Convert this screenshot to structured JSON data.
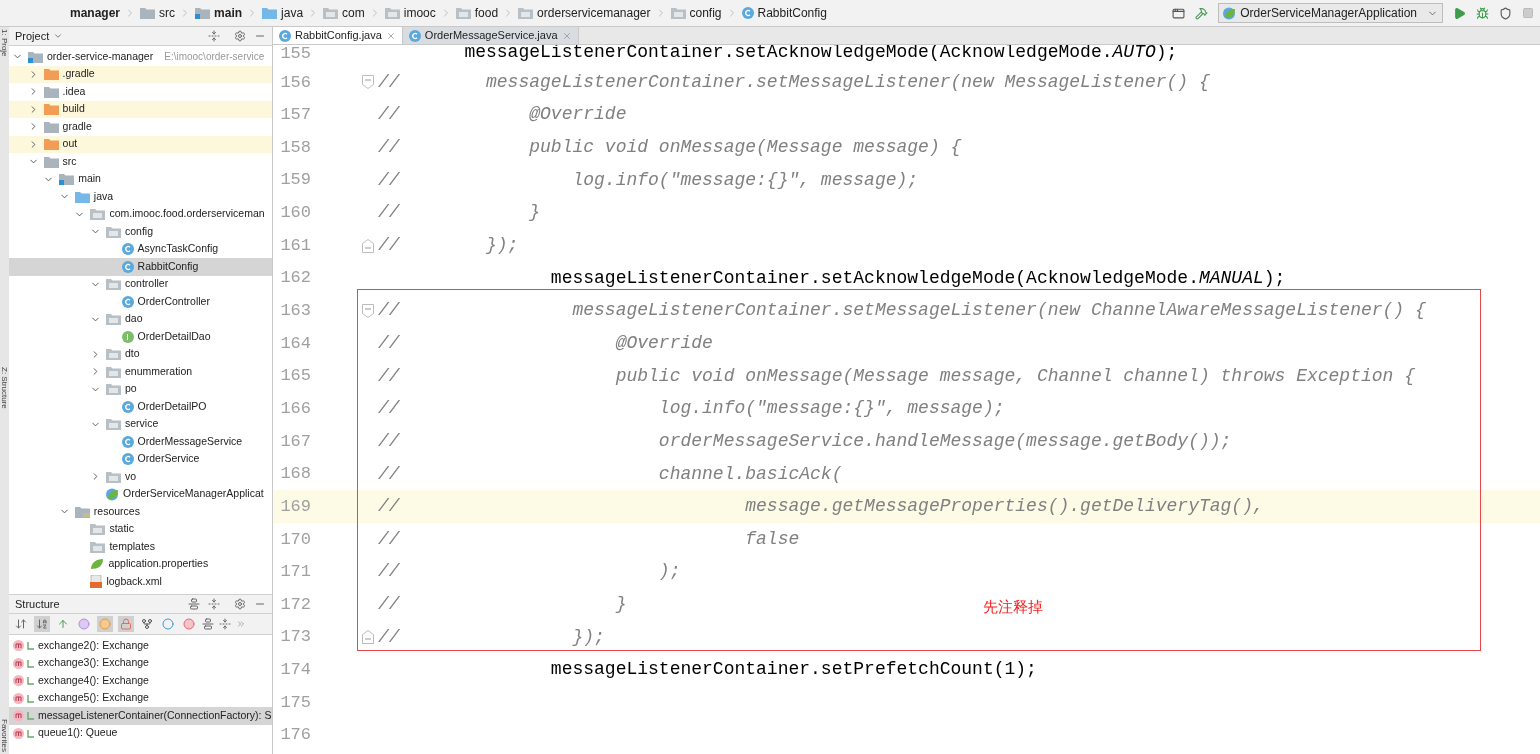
{
  "breadcrumbs": [
    {
      "label": "manager",
      "kind": "module"
    },
    {
      "label": "src",
      "kind": "folder"
    },
    {
      "label": "main",
      "kind": "source-set"
    },
    {
      "label": "java",
      "kind": "source"
    },
    {
      "label": "com",
      "kind": "package"
    },
    {
      "label": "imooc",
      "kind": "package"
    },
    {
      "label": "food",
      "kind": "package"
    },
    {
      "label": "orderservicemanager",
      "kind": "package"
    },
    {
      "label": "config",
      "kind": "package"
    },
    {
      "label": "RabbitConfig",
      "kind": "class"
    }
  ],
  "run_config": {
    "label": "OrderServiceManagerApplication"
  },
  "side_stripe": [
    "1: Proje",
    "Z: Structure",
    "Favorites"
  ],
  "project_panel": {
    "title": "Project",
    "tree": [
      {
        "label": "order-service-manager",
        "hint": "E:\\imooc\\order-service",
        "kind": "module",
        "expanded": true,
        "selected": false,
        "ignored": false,
        "children": [
          {
            "label": ".gradle",
            "kind": "excluded",
            "expanded": false,
            "selected": false,
            "ignored": true
          },
          {
            "label": ".idea",
            "kind": "folder",
            "expanded": false,
            "selected": false,
            "ignored": false
          },
          {
            "label": "build",
            "kind": "excluded",
            "expanded": false,
            "selected": false,
            "ignored": true
          },
          {
            "label": "gradle",
            "kind": "folder",
            "expanded": false,
            "selected": false,
            "ignored": false
          },
          {
            "label": "out",
            "kind": "excluded",
            "expanded": false,
            "selected": false,
            "ignored": true
          },
          {
            "label": "src",
            "kind": "folder",
            "expanded": true,
            "selected": false,
            "ignored": false,
            "children": [
              {
                "label": "main",
                "kind": "source-set",
                "expanded": true,
                "selected": false,
                "ignored": false,
                "children": [
                  {
                    "label": "java",
                    "kind": "source",
                    "expanded": true,
                    "selected": false,
                    "ignored": false,
                    "children": [
                      {
                        "label": "com.imooc.food.orderserviceman",
                        "kind": "package",
                        "expanded": true,
                        "selected": false,
                        "ignored": false,
                        "children": [
                          {
                            "label": "config",
                            "kind": "package",
                            "expanded": true,
                            "selected": false,
                            "ignored": false,
                            "children": [
                              {
                                "label": "AsyncTaskConfig",
                                "kind": "class",
                                "selected": false,
                                "ignored": false
                              },
                              {
                                "label": "RabbitConfig",
                                "kind": "class",
                                "selected": true,
                                "ignored": false
                              }
                            ]
                          },
                          {
                            "label": "controller",
                            "kind": "package",
                            "expanded": true,
                            "selected": false,
                            "ignored": false,
                            "children": [
                              {
                                "label": "OrderController",
                                "kind": "class",
                                "selected": false,
                                "ignored": false
                              }
                            ]
                          },
                          {
                            "label": "dao",
                            "kind": "package",
                            "expanded": true,
                            "selected": false,
                            "ignored": false,
                            "children": [
                              {
                                "label": "OrderDetailDao",
                                "kind": "interface",
                                "selected": false,
                                "ignored": false
                              }
                            ]
                          },
                          {
                            "label": "dto",
                            "kind": "package",
                            "expanded": false,
                            "selected": false,
                            "ignored": false
                          },
                          {
                            "label": "enummeration",
                            "kind": "package",
                            "expanded": false,
                            "selected": false,
                            "ignored": false
                          },
                          {
                            "label": "po",
                            "kind": "package",
                            "expanded": true,
                            "selected": false,
                            "ignored": false,
                            "children": [
                              {
                                "label": "OrderDetailPO",
                                "kind": "class",
                                "selected": false,
                                "ignored": false
                              }
                            ]
                          },
                          {
                            "label": "service",
                            "kind": "package",
                            "expanded": true,
                            "selected": false,
                            "ignored": false,
                            "children": [
                              {
                                "label": "OrderMessageService",
                                "kind": "class",
                                "selected": false,
                                "ignored": false
                              },
                              {
                                "label": "OrderService",
                                "kind": "class",
                                "selected": false,
                                "ignored": false
                              }
                            ]
                          },
                          {
                            "label": "vo",
                            "kind": "package",
                            "expanded": false,
                            "selected": false,
                            "ignored": false
                          },
                          {
                            "label": "OrderServiceManagerApplicat",
                            "kind": "spring-app",
                            "selected": false,
                            "ignored": false
                          }
                        ]
                      }
                    ]
                  },
                  {
                    "label": "resources",
                    "kind": "resources",
                    "expanded": true,
                    "selected": false,
                    "ignored": false,
                    "children": [
                      {
                        "label": "static",
                        "kind": "package",
                        "selected": false,
                        "ignored": false
                      },
                      {
                        "label": "templates",
                        "kind": "package",
                        "selected": false,
                        "ignored": false
                      },
                      {
                        "label": "application.properties",
                        "kind": "properties",
                        "selected": false,
                        "ignored": false
                      },
                      {
                        "label": "logback.xml",
                        "kind": "xml",
                        "selected": false,
                        "ignored": false
                      }
                    ]
                  }
                ]
              }
            ]
          }
        ]
      }
    ]
  },
  "structure_panel": {
    "title": "Structure",
    "toggles": [
      {
        "kind": "sort-visibility",
        "selected": false
      },
      {
        "kind": "sort-alpha",
        "selected": true
      },
      {
        "kind": "inherited",
        "selected": false
      },
      {
        "kind": "properties",
        "selected": false
      },
      {
        "kind": "fields",
        "selected": true
      },
      {
        "kind": "non-public",
        "selected": true
      },
      {
        "kind": "hierarchy",
        "selected": false
      },
      {
        "kind": "anonymous",
        "selected": false
      },
      {
        "kind": "lambdas",
        "selected": false
      }
    ],
    "items": [
      {
        "label": "exchange2(): Exchange",
        "selected": false
      },
      {
        "label": "exchange3(): Exchange",
        "selected": false
      },
      {
        "label": "exchange4(): Exchange",
        "selected": false
      },
      {
        "label": "exchange5(): Exchange",
        "selected": false
      },
      {
        "label": "messageListenerContainer(ConnectionFactory): S",
        "selected": true
      },
      {
        "label": "queue1(): Queue",
        "selected": false
      }
    ]
  },
  "tabs": [
    {
      "label": "RabbitConfig.java",
      "selected": true
    },
    {
      "label": "OrderMessageService.java",
      "selected": false
    }
  ],
  "editor": {
    "lines": [
      {
        "number": "155",
        "kind": "code",
        "code": "        messageListenerContainer.setAcknowledgeMode(AcknowledgeMode.*AUTO*);",
        "current": false,
        "boxed": false
      },
      {
        "number": "156",
        "kind": "comment",
        "fold_start": true,
        "fold_end": false,
        "code": "//        messageListenerContainer.setMessageListener(new MessageListener() {",
        "current": false,
        "boxed": false
      },
      {
        "number": "157",
        "kind": "comment",
        "code": "//            @Override",
        "current": false,
        "boxed": false
      },
      {
        "number": "158",
        "kind": "comment",
        "code": "//            public void onMessage(Message message) {",
        "current": false,
        "boxed": false
      },
      {
        "number": "159",
        "kind": "comment",
        "code": "//                log.info(\"message:{}\", message);",
        "current": false,
        "boxed": false
      },
      {
        "number": "160",
        "kind": "comment",
        "code": "//            }",
        "current": false,
        "boxed": false
      },
      {
        "number": "161",
        "kind": "comment",
        "fold_start": false,
        "fold_end": true,
        "code": "//        });",
        "current": false,
        "boxed": false
      },
      {
        "number": "162",
        "kind": "code",
        "code": "                messageListenerContainer.setAcknowledgeMode(AcknowledgeMode.*MANUAL*);",
        "current": false,
        "boxed": false
      },
      {
        "number": "163",
        "kind": "comment",
        "fold_start": true,
        "fold_end": false,
        "code": "//                messageListenerContainer.setMessageListener(new ChannelAwareMessageListener() {",
        "current": false,
        "boxed": true
      },
      {
        "number": "164",
        "kind": "comment",
        "code": "//                    @Override",
        "current": false,
        "boxed": true
      },
      {
        "number": "165",
        "kind": "comment",
        "code": "//                    public void onMessage(Message message, Channel channel) throws Exception {",
        "current": false,
        "boxed": true
      },
      {
        "number": "166",
        "kind": "comment",
        "code": "//                        log.info(\"message:{}\", message);",
        "current": false,
        "boxed": true
      },
      {
        "number": "167",
        "kind": "comment",
        "code": "//                        orderMessageService.handleMessage(message.getBody());",
        "current": false,
        "boxed": true
      },
      {
        "number": "168",
        "kind": "comment",
        "code": "//                        channel.basicAck(",
        "current": false,
        "boxed": true
      },
      {
        "number": "169",
        "kind": "comment",
        "code": "//                                message.getMessageProperties().getDeliveryTag(),",
        "current": true,
        "boxed": true
      },
      {
        "number": "170",
        "kind": "comment",
        "code": "//                                false",
        "current": false,
        "boxed": true
      },
      {
        "number": "171",
        "kind": "comment",
        "code": "//                        );",
        "current": false,
        "boxed": true
      },
      {
        "number": "172",
        "kind": "comment",
        "code": "//                    }",
        "current": false,
        "boxed": true
      },
      {
        "number": "173",
        "kind": "comment",
        "fold_start": false,
        "fold_end": true,
        "code": "//                });",
        "current": false,
        "boxed": true
      },
      {
        "number": "174",
        "kind": "code",
        "code": "                messageListenerContainer.setPrefetchCount(1);",
        "current": false,
        "boxed": false
      },
      {
        "number": "175",
        "kind": "code",
        "current": false,
        "boxed": false
      },
      {
        "number": "176",
        "kind": "code",
        "current": false,
        "boxed": false
      }
    ],
    "annotation": {
      "note": "先注释掉"
    }
  }
}
